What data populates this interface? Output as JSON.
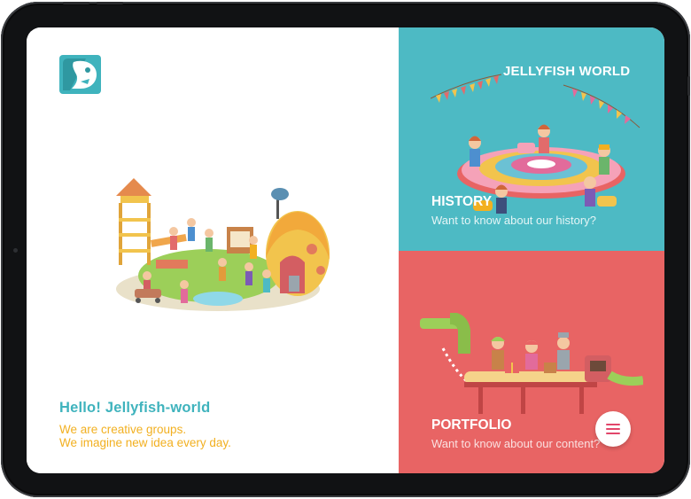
{
  "brand": {
    "name": "JELLYFISH WORLD",
    "logo_icon": "jellyfish-logo-icon"
  },
  "intro": {
    "heading": "Hello! Jellyfish-world",
    "tagline_1": "We are creative groups.",
    "tagline_2": "We imagine new idea every day."
  },
  "history": {
    "title": "HISTORY",
    "subtitle": "Want to know about our history?"
  },
  "portfolio": {
    "title": "PORTFOLIO",
    "subtitle": "Want to know about our content?"
  },
  "menu": {
    "icon": "hamburger-menu-icon"
  },
  "colors": {
    "teal": "#4dbac4",
    "coral": "#e86464",
    "heading_teal": "#3fb3bd",
    "tagline_yellow": "#f2b021",
    "menu_icon": "#e2466a"
  }
}
